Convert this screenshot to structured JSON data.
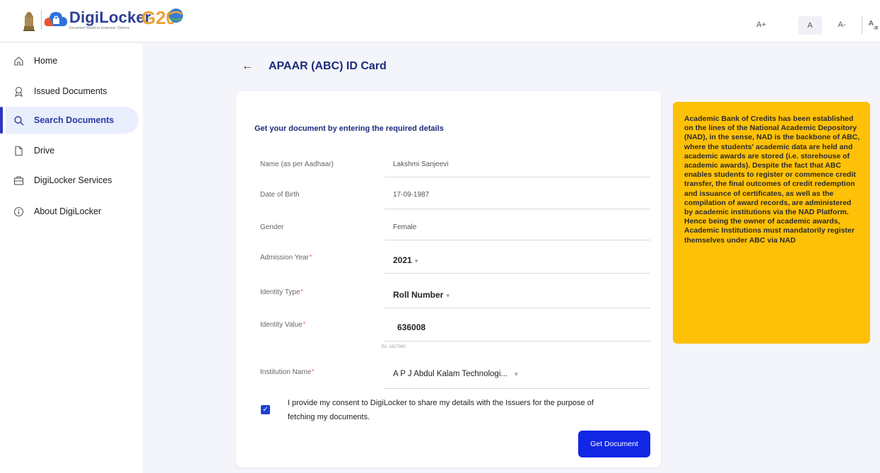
{
  "header": {
    "brand": "DigiLocker",
    "brand_tagline": "Document Wallet to Empower Citizens",
    "g20": "G20",
    "font_plus": "A+",
    "font_normal": "A",
    "font_minus": "A-"
  },
  "sidebar": {
    "items": [
      {
        "label": "Home",
        "icon": "home-icon"
      },
      {
        "label": "Issued Documents",
        "icon": "award-icon"
      },
      {
        "label": "Search Documents",
        "icon": "search-icon"
      },
      {
        "label": "Drive",
        "icon": "file-icon"
      },
      {
        "label": "DigiLocker Services",
        "icon": "briefcase-icon"
      },
      {
        "label": "About DigiLocker",
        "icon": "info-icon"
      }
    ],
    "active_index": 2
  },
  "page": {
    "title": "APAAR (ABC) ID Card"
  },
  "form": {
    "heading": "Get your document by entering the required details",
    "fields": [
      {
        "label": "Name (as per Aadhaar)",
        "value": "Lakshmi Sanjeevi",
        "required": false
      },
      {
        "label": "Date of Birth",
        "value": "17-09-1987",
        "required": false
      },
      {
        "label": "Gender",
        "value": "Female",
        "required": false
      },
      {
        "label": "Admission Year",
        "value": "2021",
        "required": true
      },
      {
        "label": "Identity Type",
        "value": "Roll Number",
        "required": true
      },
      {
        "label": "Identity Value",
        "value": "636008",
        "required": true,
        "hint": "Ex. 1627000"
      },
      {
        "label": "Institution Name",
        "value": "A P J Abdul Kalam Technologi...",
        "required": true
      }
    ],
    "consent": "I provide my consent to DigiLocker to share my details with the Issuers for the purpose of fetching my documents.",
    "consent_checked": true,
    "submit_label": "Get Document"
  },
  "info": {
    "text": "Academic Bank of Credits has been established on the lines of the National Academic Depository (NAD), in the sense, NAD is the backbone of ABC, where the students' academic data are held and academic awards are stored (i.e. storehouse of academic awards). Despite the fact that ABC enables students to register or commence credit transfer, the final outcomes of credit redemption and issuance of certificates, as well as the compilation of award records, are administered by academic institutions via the NAD Platform. Hence being the owner of academic awards, Academic Institutions must mandatorily register themselves under ABC via NAD"
  },
  "colors": {
    "primary": "#1226e6",
    "title": "#1b2c7a",
    "info_bg": "#ffc107",
    "active_bg": "#e8eefc"
  }
}
